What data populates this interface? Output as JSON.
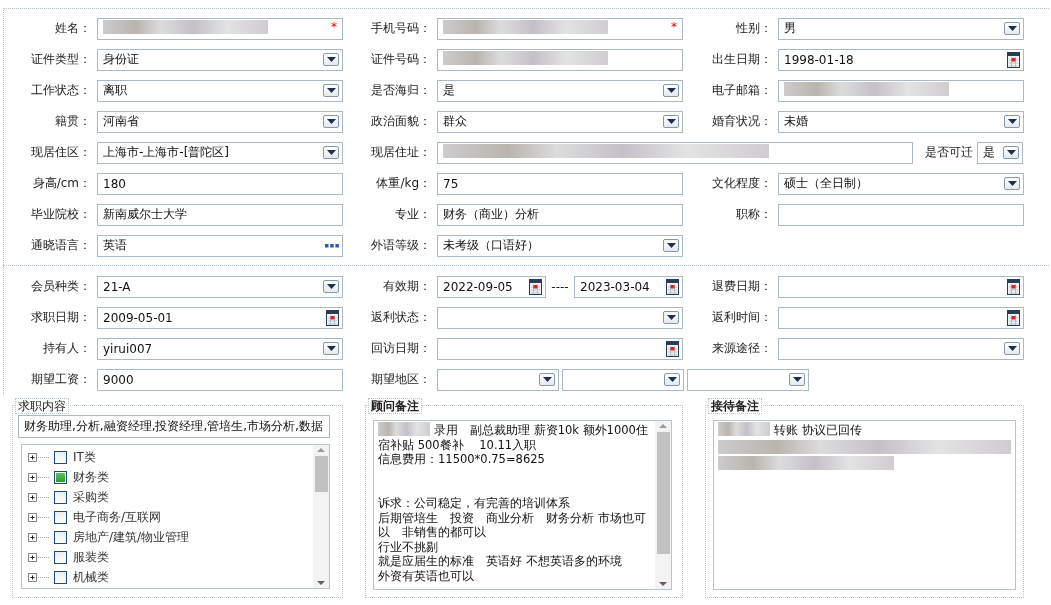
{
  "personal": {
    "rows": [
      [
        {
          "kind": "field",
          "label": "姓名：",
          "field": {
            "kind": "redacted",
            "required_mark": "*"
          }
        },
        {
          "kind": "field",
          "label": "手机号码：",
          "field": {
            "kind": "redacted",
            "required_mark": "*"
          }
        },
        {
          "kind": "field",
          "label": "性别：",
          "field": {
            "kind": "select",
            "value": "男"
          }
        }
      ],
      [
        {
          "kind": "field",
          "label": "证件类型：",
          "field": {
            "kind": "select",
            "value": "身份证"
          }
        },
        {
          "kind": "field",
          "label": "证件号码：",
          "field": {
            "kind": "redacted"
          }
        },
        {
          "kind": "field",
          "label": "出生日期：",
          "field": {
            "kind": "date",
            "value": "1998-01-18"
          }
        }
      ],
      [
        {
          "kind": "field",
          "label": "工作状态：",
          "field": {
            "kind": "select",
            "value": "离职"
          }
        },
        {
          "kind": "field",
          "label": "是否海归：",
          "field": {
            "kind": "select",
            "value": "是"
          }
        },
        {
          "kind": "field",
          "label": "电子邮箱：",
          "field": {
            "kind": "redacted"
          }
        }
      ],
      [
        {
          "kind": "field",
          "label": "籍贯：",
          "field": {
            "kind": "select",
            "value": "河南省"
          }
        },
        {
          "kind": "field",
          "label": "政治面貌：",
          "field": {
            "kind": "select",
            "value": "群众"
          }
        },
        {
          "kind": "field",
          "label": "婚育状况：",
          "field": {
            "kind": "select",
            "value": "未婚"
          }
        }
      ],
      [
        {
          "kind": "field",
          "label": "现居住区：",
          "field": {
            "kind": "select",
            "value": "上海市-上海市-[普陀区]"
          }
        },
        {
          "kind": "wide",
          "label": "现居住址：",
          "field": {
            "kind": "redacted"
          },
          "extra_label": "是否可迁",
          "extra_field": {
            "kind": "select",
            "value": "是"
          }
        }
      ],
      [
        {
          "kind": "field",
          "label": "身高/cm：",
          "field": {
            "kind": "text",
            "value": "180"
          }
        },
        {
          "kind": "field",
          "label": "体重/kg：",
          "field": {
            "kind": "text",
            "value": "75"
          }
        },
        {
          "kind": "field",
          "label": "文化程度：",
          "field": {
            "kind": "select",
            "value": "硕士（全日制）"
          }
        }
      ],
      [
        {
          "kind": "field",
          "label": "毕业院校：",
          "field": {
            "kind": "text",
            "value": "新南威尔士大学"
          }
        },
        {
          "kind": "field",
          "label": "专业：",
          "field": {
            "kind": "text",
            "value": "财务（商业）分析"
          }
        },
        {
          "kind": "field",
          "label": "职称：",
          "field": {
            "kind": "text"
          }
        }
      ],
      [
        {
          "kind": "field",
          "label": "通晓语言：",
          "field": {
            "kind": "lookup",
            "value": "英语"
          }
        },
        {
          "kind": "field",
          "label": "外语等级：",
          "field": {
            "kind": "select",
            "value": "未考级（口语好）"
          }
        }
      ]
    ]
  },
  "membership": {
    "rows": [
      [
        {
          "kind": "field",
          "label": "会员种类：",
          "field": {
            "kind": "select",
            "value": "21-A"
          }
        },
        {
          "kind": "range",
          "label": "有效期：",
          "from": {
            "kind": "date",
            "value": "2022-09-05"
          },
          "separator": "----",
          "to": {
            "kind": "date",
            "value": "2023-03-04"
          }
        },
        {
          "kind": "field",
          "label": "退费日期：",
          "field": {
            "kind": "date"
          }
        }
      ],
      [
        {
          "kind": "field",
          "label": "求职日期：",
          "field": {
            "kind": "date",
            "value": "2009-05-01"
          }
        },
        {
          "kind": "field",
          "label": "返利状态：",
          "field": {
            "kind": "select"
          }
        },
        {
          "kind": "field",
          "label": "返利时间：",
          "field": {
            "kind": "date"
          }
        }
      ],
      [
        {
          "kind": "field",
          "label": "持有人：",
          "field": {
            "kind": "select",
            "value": "yirui007"
          }
        },
        {
          "kind": "field",
          "label": "回访日期：",
          "field": {
            "kind": "date"
          }
        },
        {
          "kind": "field",
          "label": "来源途径：",
          "field": {
            "kind": "select"
          }
        }
      ],
      [
        {
          "kind": "field",
          "label": "期望工资：",
          "field": {
            "kind": "text",
            "value": "9000"
          }
        },
        {
          "kind": "multi",
          "label": "期望地区：",
          "fields": [
            {
              "kind": "select"
            },
            {
              "kind": "select"
            },
            {
              "kind": "select"
            }
          ]
        }
      ]
    ]
  },
  "job_content": {
    "title": "求职内容",
    "value": "财务助理,分析,融资经理,投资经理,管培生,市场分析,数据",
    "tree": [
      {
        "label": "IT类",
        "checked": false,
        "expanded": false
      },
      {
        "label": "财务类",
        "checked": true,
        "expanded": false
      },
      {
        "label": "采购类",
        "checked": false,
        "expanded": false
      },
      {
        "label": "电子商务/互联网",
        "checked": false,
        "expanded": false
      },
      {
        "label": "房地产/建筑/物业管理",
        "checked": false,
        "expanded": false
      },
      {
        "label": "服装类",
        "checked": false,
        "expanded": false
      },
      {
        "label": "机械类",
        "checked": false,
        "expanded": false
      }
    ]
  },
  "notes": [
    {
      "title": "顾问备注",
      "scrollable": true,
      "lines": [
        {
          "kind": "text",
          "blur_before": true,
          "text": "录用　副总裁助理 薪资10k 额外1000住"
        },
        {
          "kind": "text",
          "text": "宿补贴 500餐补　 10.11入职"
        },
        {
          "kind": "text",
          "text": "信息费用：11500*0.75=8625"
        },
        {
          "kind": "blank"
        },
        {
          "kind": "blank"
        },
        {
          "kind": "text",
          "text": "诉求：公司稳定，有完善的培训体系"
        },
        {
          "kind": "text",
          "text": "后期管培生　投资　商业分析　财务分析 市场也可"
        },
        {
          "kind": "text",
          "text": "以　非销售的都可以"
        },
        {
          "kind": "text",
          "text": "行业不挑剔"
        },
        {
          "kind": "text",
          "text": "就是应届生的标准　英语好 不想英语多的环境"
        },
        {
          "kind": "text",
          "text": "外资有英语也可以"
        }
      ]
    },
    {
      "title": "接待备注",
      "scrollable": false,
      "lines": [
        {
          "kind": "text",
          "blur_before": true,
          "text": "转账 协议已回传"
        },
        {
          "kind": "blur_line"
        },
        {
          "kind": "blur_partial"
        }
      ]
    }
  ]
}
